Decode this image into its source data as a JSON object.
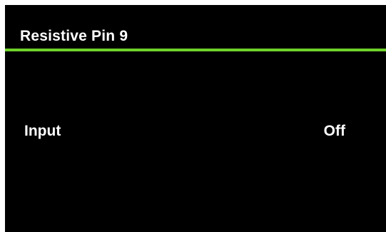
{
  "header": {
    "title": "Resistive Pin 9"
  },
  "settings": [
    {
      "label": "Input",
      "value": "Off"
    }
  ],
  "colors": {
    "background": "#000000",
    "text": "#ffffff",
    "accent": "#6fd12a"
  }
}
